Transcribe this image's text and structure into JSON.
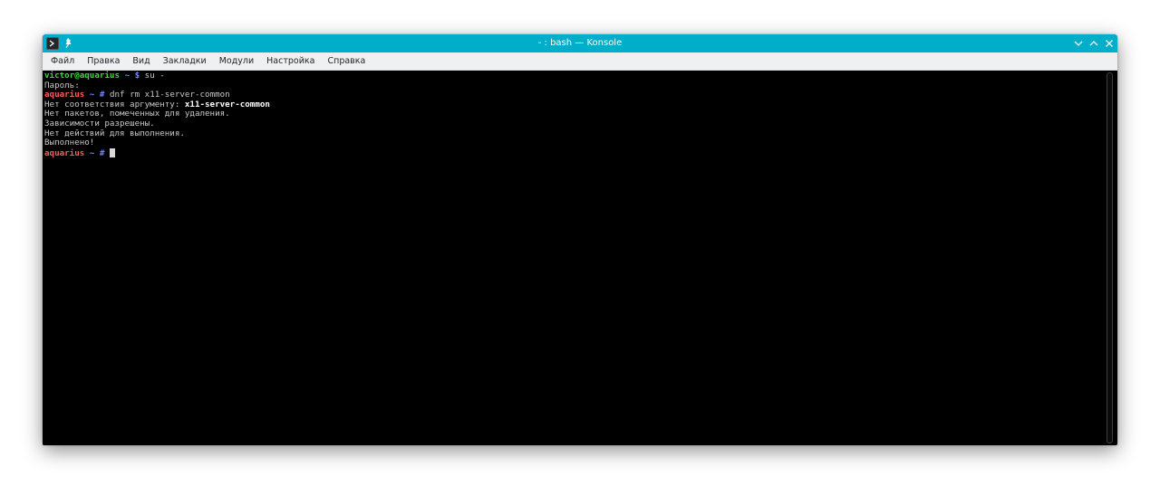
{
  "window": {
    "title": "- : bash — Konsole",
    "accent_color": "#00aec9",
    "icons": {
      "app": "konsole-terminal-icon",
      "pin": "pin-icon",
      "minimize": "chevron-down-icon",
      "maximize": "chevron-up-icon",
      "close": "close-icon"
    }
  },
  "menu": {
    "items": [
      "Файл",
      "Правка",
      "Вид",
      "Закладки",
      "Модули",
      "Настройка",
      "Справка"
    ]
  },
  "terminal": {
    "lines": [
      {
        "user": "victor@aquarius",
        "path": " ~ ",
        "symbol": "$",
        "command": " su -"
      },
      {
        "text": "Пароль:"
      },
      {
        "user": "aquarius",
        "path": " ~ ",
        "symbol": "#",
        "command": " dnf rm x11-server-common"
      },
      {
        "text": "Нет соответствия аргументу: ",
        "bold": "x11-server-common"
      },
      {
        "text": "Нет пакетов, помеченных для удаления."
      },
      {
        "text": "Зависимости разрешены."
      },
      {
        "text": "Нет действий для выполнения."
      },
      {
        "text": "Выполнено!"
      },
      {
        "user": "aquarius",
        "path": " ~ ",
        "symbol": "#",
        "command": " "
      }
    ]
  }
}
